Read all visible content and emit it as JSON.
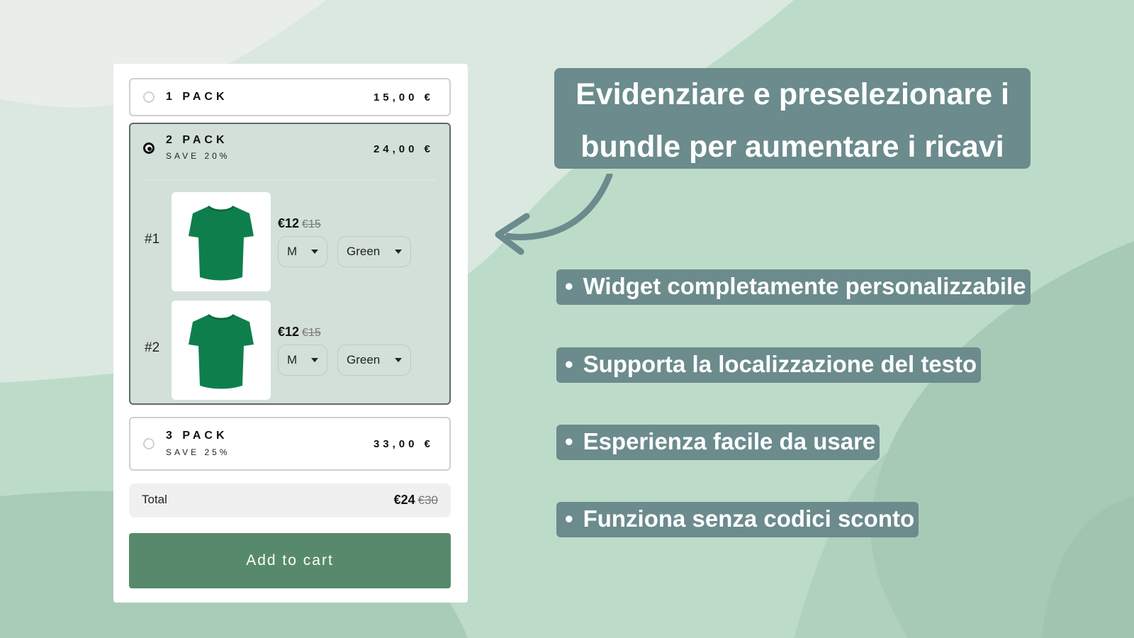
{
  "colors": {
    "accent_green": "#578a6c",
    "label_bg": "#6b8b8d",
    "selected_bg": "#d2e0d9",
    "tshirt": "#0e7f4c"
  },
  "widget": {
    "options": [
      {
        "title": "1 PACK",
        "subtitle": "",
        "price": "15,00 €",
        "selected": false
      },
      {
        "title": "2 PACK",
        "subtitle": "SAVE 20%",
        "price": "24,00 €",
        "selected": true
      },
      {
        "title": "3 PACK",
        "subtitle": "SAVE 25%",
        "price": "33,00 €",
        "selected": false
      }
    ],
    "items": [
      {
        "number": "#1",
        "price": "€12",
        "old_price": "€15",
        "size": "M",
        "color": "Green",
        "image": "green-tshirt"
      },
      {
        "number": "#2",
        "price": "€12",
        "old_price": "€15",
        "size": "M",
        "color": "Green",
        "image": "green-tshirt"
      }
    ],
    "total": {
      "label": "Total",
      "price": "€24",
      "old_price": "€30"
    },
    "add_to_cart": "Add to cart"
  },
  "promo": {
    "headline_line1": "Evidenziare e preselezionare i",
    "headline_line2": "bundle per aumentare i ricavi",
    "bullet_symbol": "•",
    "bullets": [
      "Widget completamente personalizzabile",
      "Supporta la localizzazione del testo",
      "Esperienza facile da usare",
      "Funziona senza codici sconto"
    ],
    "arrow_icon": "curved-arrow-left"
  }
}
